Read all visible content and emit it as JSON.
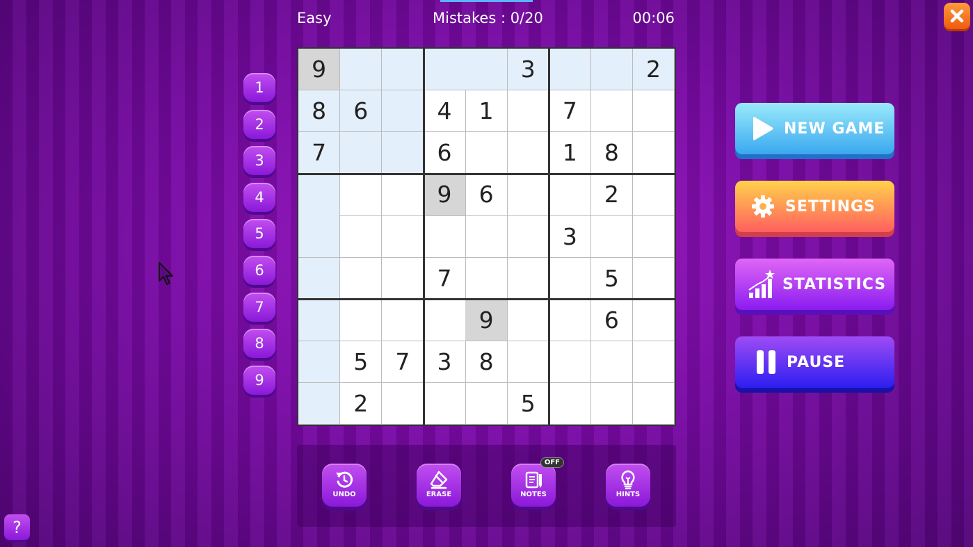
{
  "header": {
    "difficulty": "Easy",
    "mistakes": "Mistakes : 0/20",
    "timer": "00:06"
  },
  "numpad": [
    "1",
    "2",
    "3",
    "4",
    "5",
    "6",
    "7",
    "8",
    "9"
  ],
  "board": {
    "cells": [
      [
        "9",
        "",
        "",
        "",
        "",
        "3",
        "",
        "",
        "2"
      ],
      [
        "8",
        "6",
        "",
        "4",
        "1",
        "",
        "7",
        "",
        ""
      ],
      [
        "7",
        "",
        "",
        "6",
        "",
        "",
        "1",
        "8",
        ""
      ],
      [
        "",
        "",
        "",
        "9",
        "6",
        "",
        "",
        "2",
        ""
      ],
      [
        "",
        "",
        "",
        "",
        "",
        "",
        "3",
        "",
        ""
      ],
      [
        "",
        "",
        "",
        "7",
        "",
        "",
        "",
        "5",
        ""
      ],
      [
        "",
        "",
        "",
        "",
        "9",
        "",
        "",
        "6",
        ""
      ],
      [
        "",
        "5",
        "7",
        "3",
        "8",
        "",
        "",
        "",
        ""
      ],
      [
        "",
        "2",
        "",
        "",
        "",
        "5",
        "",
        "",
        ""
      ]
    ],
    "selected_cell": [
      0,
      0
    ]
  },
  "menu": {
    "new_game": "NEW GAME",
    "settings": "SETTINGS",
    "statistics": "STATISTICS",
    "pause": "PAUSE"
  },
  "tools": {
    "undo": "UNDO",
    "erase": "ERASE",
    "notes": "NOTES",
    "notes_state": "OFF",
    "hints": "HINTS"
  },
  "help": "?"
}
